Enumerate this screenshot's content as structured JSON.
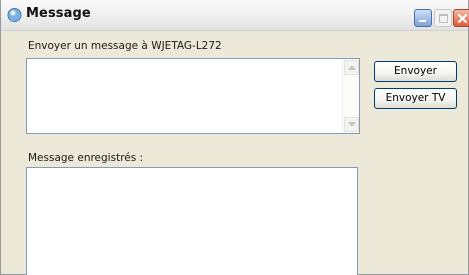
{
  "window": {
    "title": "Message",
    "controls": {
      "minimize_icon": "minimize-icon",
      "maximize_icon": "maximize-icon",
      "close_icon": "close-icon"
    }
  },
  "form": {
    "send_label": "Envoyer un message à WJETAG-L272",
    "message_value": "",
    "saved_label": "Message enregistrés :",
    "saved_value": ""
  },
  "buttons": {
    "send": "Envoyer",
    "send_tv": "Envoyer TV"
  },
  "colors": {
    "window_bg": "#ece9d8",
    "field_border": "#7f9db9",
    "button_border": "#003c74",
    "close_button": "#e05a3a",
    "minimize_button": "#7fa3d6"
  }
}
